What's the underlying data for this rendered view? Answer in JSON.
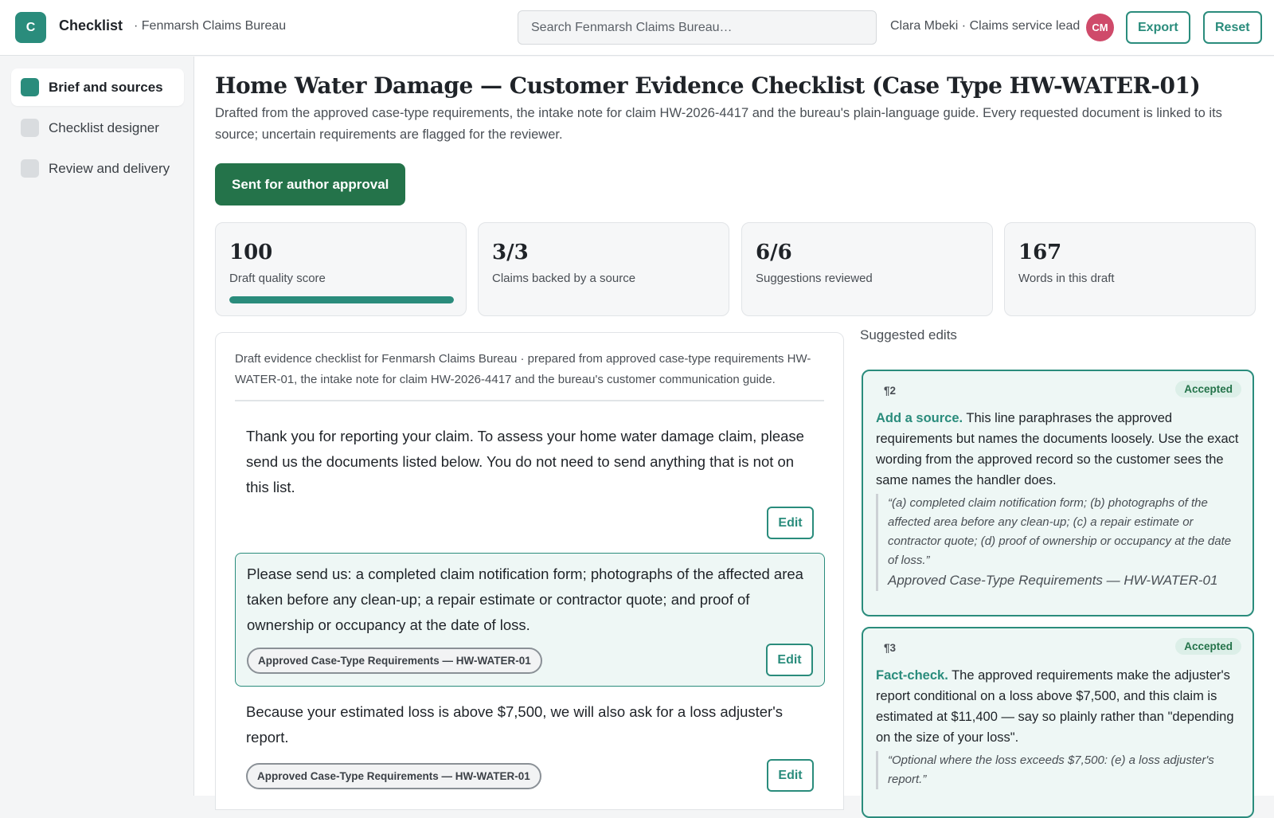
{
  "app": {
    "logo_letter": "C",
    "title": "Checklist",
    "org": "· Fenmarsh Claims Bureau",
    "search_placeholder": "Search Fenmarsh Claims Bureau…",
    "user_label": "Clara Mbeki · Claims service lead",
    "avatar_initials": "CM",
    "export_label": "Export",
    "reset_label": "Reset"
  },
  "sidebar": {
    "items": [
      {
        "label": "Brief and sources",
        "active": true
      },
      {
        "label": "Checklist designer",
        "active": false
      },
      {
        "label": "Review and delivery",
        "active": false
      }
    ]
  },
  "main": {
    "title": "Home Water Damage — Customer Evidence Checklist (Case Type HW-WATER-01)",
    "subtitle": "Drafted from the approved case-type requirements, the intake note for claim HW-2026-4417 and the bureau's plain-language guide. Every requested document is linked to its source; uncertain requirements are flagged for the reviewer.",
    "status_button": "Sent for author approval",
    "stats": [
      {
        "value": "100",
        "label": "Draft quality score",
        "progress": 1.0
      },
      {
        "value": "3/3",
        "label": "Claims backed by a source"
      },
      {
        "value": "6/6",
        "label": "Suggestions reviewed"
      },
      {
        "value": "167",
        "label": "Words in this draft"
      }
    ]
  },
  "draft": {
    "meta": "Draft evidence checklist for Fenmarsh Claims Bureau · prepared from approved case-type requirements HW-WATER-01, the intake note for claim HW-2026-4417 and the bureau's customer communication guide.",
    "edit_label": "Edit",
    "paragraphs": [
      {
        "text": "Thank you for reporting your claim. To assess your home water damage claim, please send us the documents listed below. You do not need to send anything that is not on this list.",
        "source": ""
      },
      {
        "text": "Please send us: a completed claim notification form; photographs of the affected area taken before any clean-up; a repair estimate or contractor quote; and proof of ownership or occupancy at the date of loss.",
        "source": "Approved Case-Type Requirements — HW-WATER-01"
      },
      {
        "text": "Because your estimated loss is above $7,500, we will also ask for a loss adjuster's report.",
        "source": "Approved Case-Type Requirements — HW-WATER-01"
      }
    ]
  },
  "suggestions": {
    "title": "Suggested edits",
    "items": [
      {
        "para": "¶2",
        "status": "Accepted",
        "kind": "Add a source.",
        "text": " This line paraphrases the approved requirements but names the documents loosely. Use the exact wording from the approved record so the customer sees the same names the handler does.",
        "quote": "“(a) completed claim notification form; (b) photographs of the affected area before any clean-up; (c) a repair estimate or contractor quote; (d) proof of ownership or occupancy at the date of loss.”",
        "quote_source": "Approved Case-Type Requirements — HW-WATER-01"
      },
      {
        "para": "¶3",
        "status": "Accepted",
        "kind": "Fact-check.",
        "text": " The approved requirements make the adjuster's report conditional on a loss above $7,500, and this claim is estimated at $11,400 — say so plainly rather than \"depending on the size of your loss\".",
        "quote": "“Optional where the loss exceeds $7,500: (e) a loss adjuster's report.”",
        "quote_source": ""
      }
    ]
  },
  "colors": {
    "accent": "#2a8c7c",
    "status_button": "#24734a",
    "avatar": "#cf4a6a",
    "highlight_bg": "#eef7f5"
  }
}
